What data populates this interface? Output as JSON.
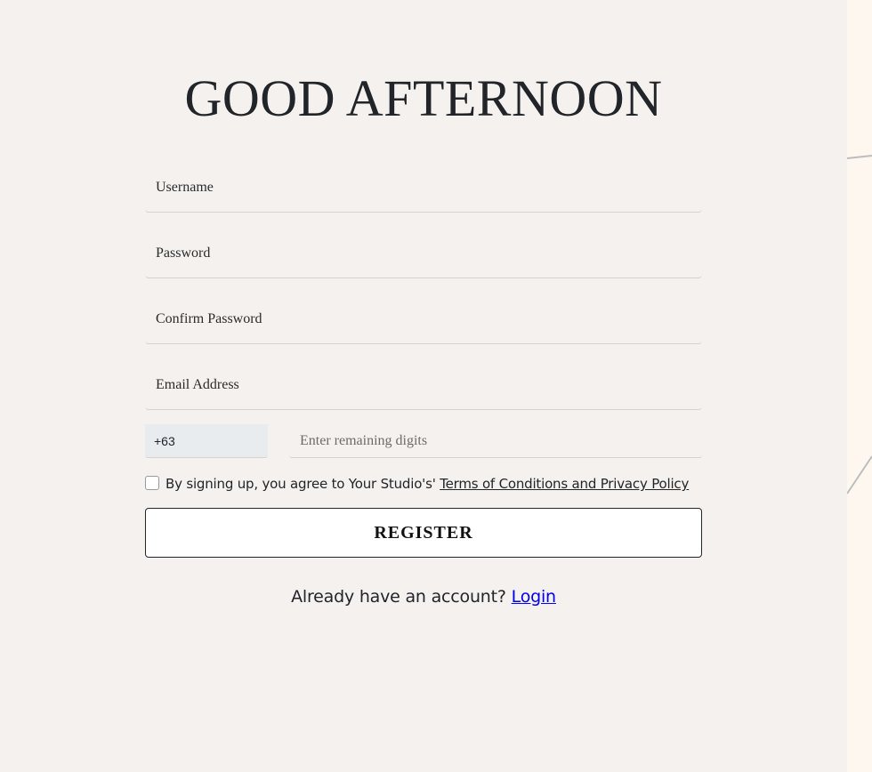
{
  "page": {
    "greeting": "GOOD AFTERNOON"
  },
  "form": {
    "username_placeholder": "Username",
    "password_placeholder": "Password",
    "confirm_password_placeholder": "Confirm Password",
    "email_placeholder": "Email Address",
    "country_code": "+63",
    "phone_placeholder": "Enter remaining digits",
    "terms_prefix": "By signing up, you agree to Your Studio's' ",
    "terms_link": "Terms of Conditions and Privacy Policy",
    "terms_checked": false,
    "register_label": "REGISTER"
  },
  "footer": {
    "login_prompt": "Already have an account? ",
    "login_link": "Login"
  },
  "colors": {
    "background": "#f5f1ee",
    "right_panel": "#fdf7f0",
    "text": "#212529",
    "link": "#0000ee",
    "country_code_bg": "#e9ecef"
  }
}
